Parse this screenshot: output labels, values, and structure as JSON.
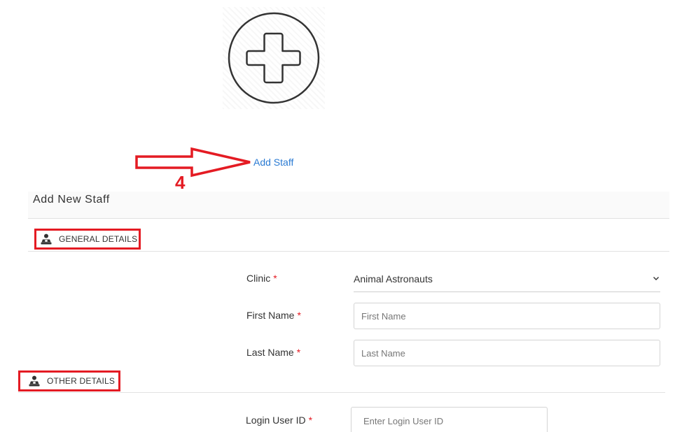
{
  "avatar_upload": {
    "icon": "plus-circle-icon"
  },
  "annotation": {
    "step_number": "4",
    "color": "#e41b23"
  },
  "add_staff_link": "Add Staff",
  "panel": {
    "title": "Add New Staff"
  },
  "sections": {
    "general": {
      "label": "GENERAL DETAILS",
      "icon": "user-group-icon"
    },
    "other": {
      "label": "OTHER DETAILS",
      "icon": "user-group-icon"
    }
  },
  "fields": {
    "clinic": {
      "label": "Clinic",
      "required_mark": "*",
      "value": "Animal Astronauts"
    },
    "first_name": {
      "label": "First Name",
      "required_mark": "*",
      "placeholder": "First Name"
    },
    "last_name": {
      "label": "Last Name",
      "required_mark": "*",
      "placeholder": "Last Name"
    },
    "login_user_id": {
      "label": "Login User ID",
      "required_mark": "*",
      "placeholder": "Enter Login User ID"
    }
  },
  "colors": {
    "link": "#2b7bd3",
    "required": "#e41b23",
    "annotation": "#e41b23"
  }
}
